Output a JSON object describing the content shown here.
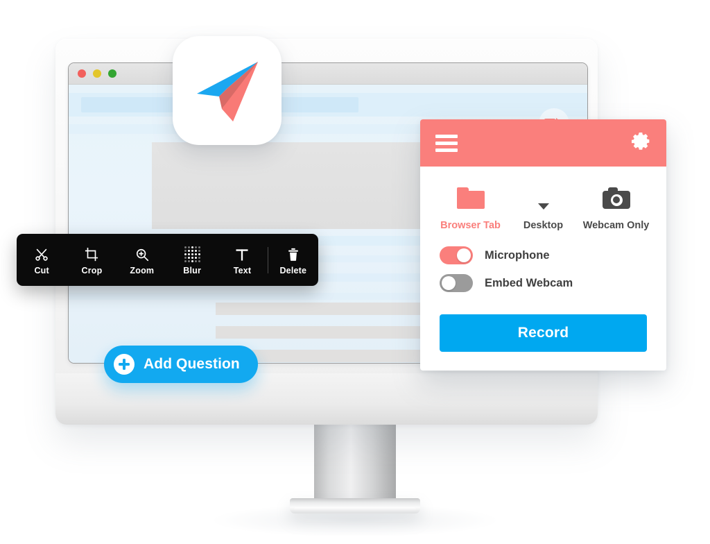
{
  "app": {
    "logo_icon": "paper-plane-logo",
    "logo_colors": {
      "wing": "#1ba7f0",
      "body": "#f97a76",
      "shade": "#d96a66"
    }
  },
  "browser_window": {
    "traffic_lights": [
      "close-red",
      "minimize-yellow",
      "maximize-green"
    ],
    "recording_indicator_icon": "video-camera-icon",
    "accent": "#fa7f7c"
  },
  "edit_toolbar": {
    "tools": [
      {
        "label": "Cut",
        "icon": "scissors-icon"
      },
      {
        "label": "Crop",
        "icon": "crop-icon"
      },
      {
        "label": "Zoom",
        "icon": "magnifier-plus-icon"
      },
      {
        "label": "Blur",
        "icon": "blur-dots-icon"
      },
      {
        "label": "Text",
        "icon": "text-t-icon"
      },
      {
        "label": "Delete",
        "icon": "trash-icon"
      }
    ],
    "background": "#0b0b0b"
  },
  "add_question": {
    "label": "Add Question",
    "icon": "plus-circle-icon",
    "color": "#12a9f0"
  },
  "recorder": {
    "header": {
      "menu_icon": "hamburger-menu-icon",
      "settings_icon": "gear-icon",
      "background": "#fa7f7c"
    },
    "sources": [
      {
        "label": "Browser Tab",
        "icon": "folder-icon",
        "selected": true
      },
      {
        "label": "Desktop",
        "icon": "monitor-icon",
        "selected": false
      },
      {
        "label": "Webcam Only",
        "icon": "camera-icon",
        "selected": false
      }
    ],
    "toggles": [
      {
        "label": "Microphone",
        "state": "on",
        "color": "#fa7f7c"
      },
      {
        "label": "Embed Webcam",
        "state": "off",
        "color": "#9b9b9b"
      }
    ],
    "record_button": {
      "label": "Record",
      "color": "#00a8f0"
    }
  }
}
